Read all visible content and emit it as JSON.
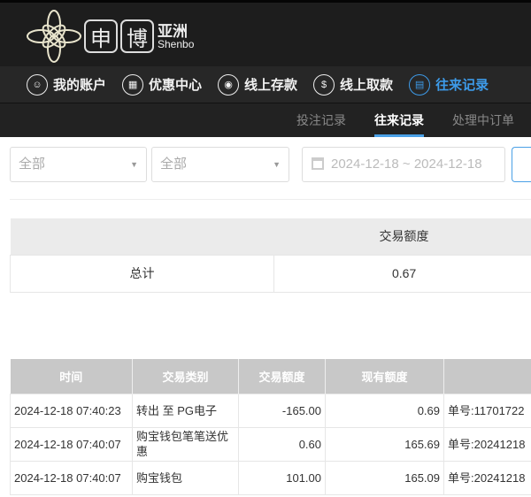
{
  "brand": {
    "box1": "申",
    "box2": "博",
    "cn": "亚洲",
    "en": "Shenbo"
  },
  "nav": [
    {
      "label": "我的账户",
      "icon": "user-icon"
    },
    {
      "label": "优惠中心",
      "icon": "gift-icon"
    },
    {
      "label": "线上存款",
      "icon": "deposit-icon"
    },
    {
      "label": "线上取款",
      "icon": "withdraw-icon"
    },
    {
      "label": "往来记录",
      "icon": "record-icon",
      "active": true
    }
  ],
  "tabs": [
    "投注记录",
    "往来记录",
    "处理中订单"
  ],
  "filters": {
    "select1": "全部",
    "select2": "全部",
    "date_range": "2024-12-18 ~ 2024-12-18"
  },
  "summary": {
    "header": "交易额度",
    "label": "总计",
    "value": "0.67"
  },
  "table": {
    "headers": [
      "时间",
      "交易类别",
      "交易额度",
      "现有额度",
      ""
    ],
    "rows": [
      [
        "2024-12-18 07:40:23",
        "转出 至 PG电子",
        "-165.00",
        "0.69",
        "单号:11701722"
      ],
      [
        "2024-12-18 07:40:07",
        "购宝钱包笔笔送优惠",
        "0.60",
        "165.69",
        "单号:20241218"
      ],
      [
        "2024-12-18 07:40:07",
        "购宝钱包",
        "101.00",
        "165.09",
        "单号:20241218"
      ]
    ]
  },
  "colors": {
    "accent": "#3d9be9",
    "header_bg": "#1d1d1d"
  }
}
